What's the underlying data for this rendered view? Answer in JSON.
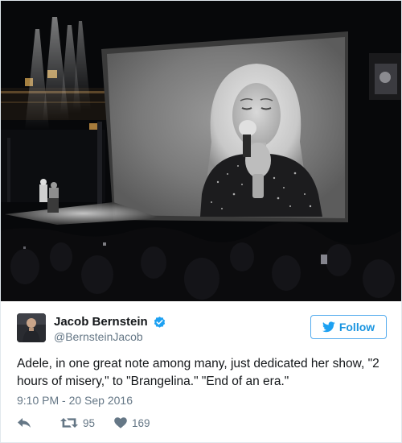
{
  "author": {
    "name": "Jacob Bernstein",
    "handle": "@BernsteinJacob",
    "verified": true
  },
  "follow": {
    "label": "Follow"
  },
  "tweet": {
    "text": "Adele, in one great note among many, just dedicated her show, \"2 hours of misery,\" to \"Brangelina.\" \"End of an era.\"",
    "timestamp": "9:10 PM - 20 Sep 2016"
  },
  "actions": {
    "retweets": "95",
    "likes": "169"
  },
  "colors": {
    "brand_blue": "#1b95e0",
    "verified_blue": "#1da1f2",
    "muted_text": "#657786",
    "border": "#e1e8ed"
  },
  "icons": [
    "verified-badge-icon",
    "twitter-bird-icon",
    "reply-icon",
    "retweet-icon",
    "heart-icon"
  ]
}
